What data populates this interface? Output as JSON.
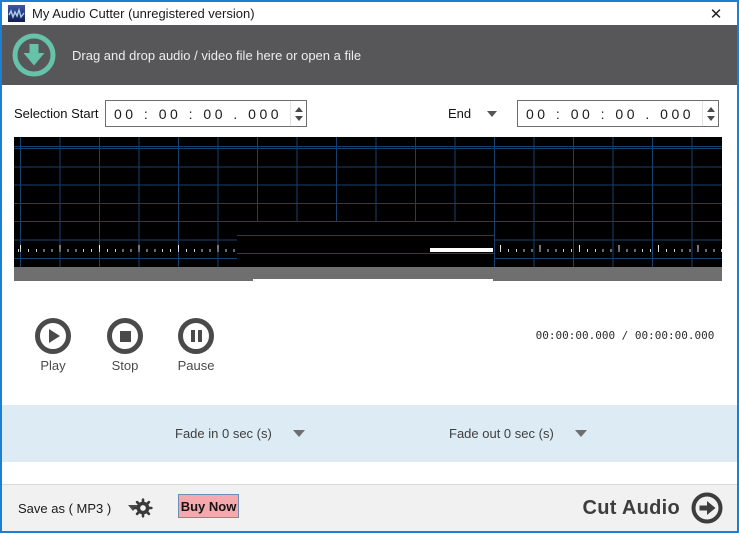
{
  "titlebar": {
    "title": "My Audio Cutter (unregistered version)",
    "close_glyph": "✕"
  },
  "dropzone": {
    "message": "Drag and drop audio / video file here or open a file"
  },
  "selection": {
    "start_label": "Selection Start",
    "start_value": "00 : 00 : 00 . 000",
    "end_label": "End",
    "end_value": "00 : 00 : 00 . 000"
  },
  "transport": {
    "play_label": "Play",
    "stop_label": "Stop",
    "pause_label": "Pause",
    "time_display": "00:00:00.000 / 00:00:00.000"
  },
  "fade": {
    "fade_in_label": "Fade in 0 sec (s)",
    "fade_out_label": "Fade out 0 sec (s)"
  },
  "footer": {
    "save_as_label": "Save as ( MP3 )",
    "buy_now_label": "Buy Now",
    "cut_audio_label": "Cut Audio"
  },
  "colors": {
    "window_border": "#1b7fd4",
    "title_text": "#1a1a1a",
    "dropzone_bg": "#57575a",
    "accent_teal": "#66c2a8",
    "waveform_bg": "#000000",
    "grid_line": "#17406e",
    "scrollbar_gray": "#6f6f70",
    "fade_panel_bg": "#dcebf4",
    "footer_bg": "#f1f1f2",
    "buy_now_bg": "#f5a9ae",
    "buy_now_border": "#6f8fae",
    "control_dark": "#4a4a4a"
  }
}
